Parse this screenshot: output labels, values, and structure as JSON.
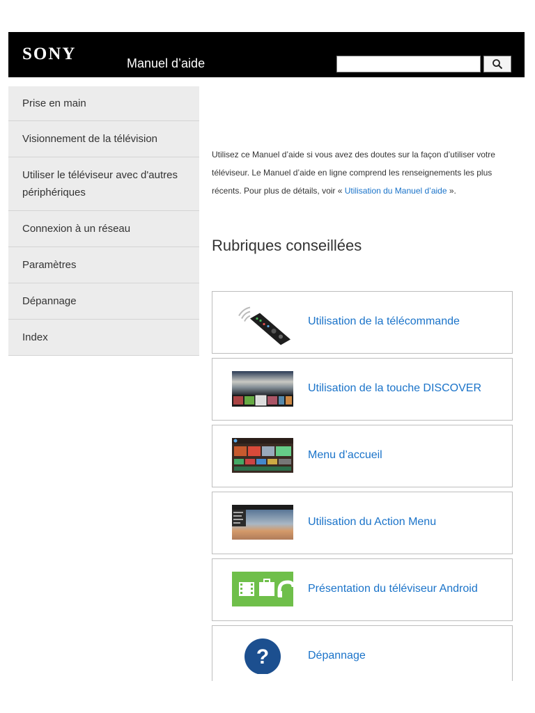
{
  "header": {
    "logo": "SONY",
    "title": "Manuel d’aide",
    "search_placeholder": "",
    "search_value": ""
  },
  "sidebar": {
    "items": [
      {
        "label": "Prise en main"
      },
      {
        "label": "Visionnement de la télévision"
      },
      {
        "label": "Utiliser le téléviseur avec d'autres périphériques"
      },
      {
        "label": "Connexion à un réseau"
      },
      {
        "label": "Paramètres"
      },
      {
        "label": "Dépannage"
      },
      {
        "label": "Index"
      }
    ]
  },
  "intro": {
    "text": "Utilisez ce Manuel d’aide si vous avez des doutes sur la façon d’utiliser votre téléviseur. Le Manuel d’aide en ligne comprend les renseignements les plus récents. Pour plus de détails, voir « ",
    "link": "Utilisation du Manuel d’aide",
    "suffix": " »."
  },
  "section_title": "Rubriques conseillées",
  "cards": [
    {
      "label": "Utilisation de la télécommande",
      "icon": "remote-control-icon"
    },
    {
      "label": "Utilisation de la touche DISCOVER",
      "icon": "discover-screen-thumbnail"
    },
    {
      "label": "Menu d’accueil",
      "icon": "home-menu-thumbnail"
    },
    {
      "label": "Utilisation du Action Menu",
      "icon": "action-menu-thumbnail"
    },
    {
      "label": "Présentation du téléviseur Android",
      "icon": "android-tv-icon"
    },
    {
      "label": "Dépannage",
      "icon": "question-mark-icon"
    }
  ],
  "colors": {
    "link": "#1a73c9",
    "header_bg": "#000000",
    "sidebar_bg": "#ececec",
    "android_green": "#6fbf4a",
    "help_blue": "#1c4f8f"
  }
}
